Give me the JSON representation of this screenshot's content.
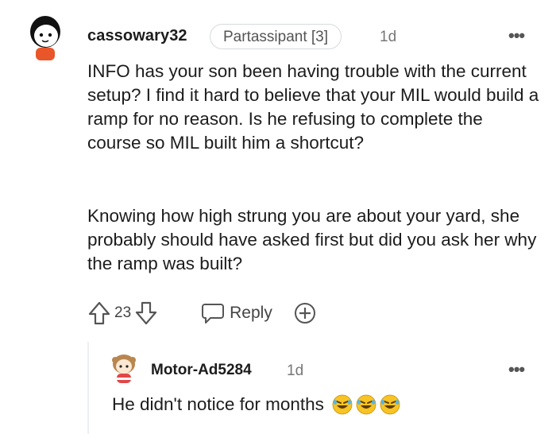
{
  "comment": {
    "username": "cassowary32",
    "flair": "Partassipant [3]",
    "age": "1d",
    "more_icon": "more-options-icon",
    "paragraphs": [
      "INFO has your son been having trouble with the current setup? I find it hard to believe that your MIL would build a ramp for no reason. Is he refusing to complete the course so MIL built him a shortcut?",
      "Knowing how high strung you are about your yard, she probably should have asked first but did you ask her why the ramp was built?"
    ],
    "score": "23",
    "reply_label": "Reply",
    "icons": [
      "upvote-icon",
      "downvote-icon",
      "reply-icon",
      "award-icon"
    ]
  },
  "reply": {
    "username": "Motor-Ad5284",
    "age": "1d",
    "text": "He didn't notice for months",
    "emoji_count": 3,
    "emoji_icon": "rolling-laughing-emoji-icon"
  },
  "colors": {
    "text": "#1c1c1c",
    "muted": "#777777",
    "border": "#d7dadc",
    "avatar_shirt": "#e8562a",
    "emoji_yellow": "#f7c325"
  }
}
